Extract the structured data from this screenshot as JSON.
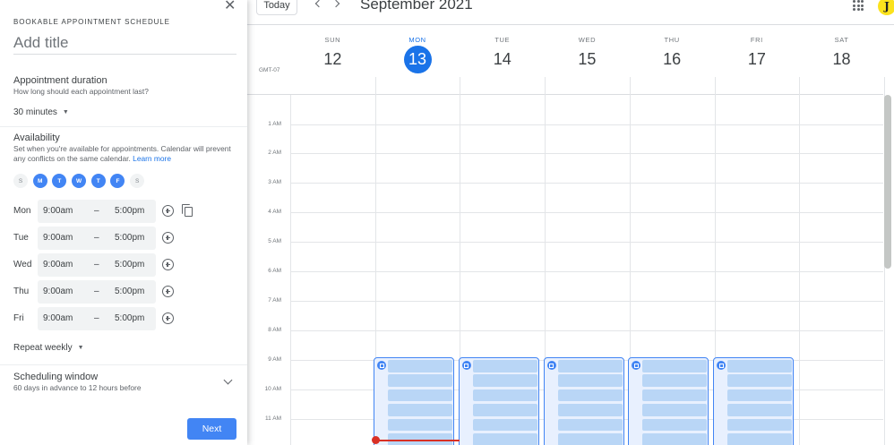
{
  "panel": {
    "heading": "BOOKABLE APPOINTMENT SCHEDULE",
    "close_icon": "close-icon",
    "title_placeholder": "Add title",
    "duration": {
      "heading": "Appointment duration",
      "subtitle": "How long should each appointment last?",
      "value": "30 minutes"
    },
    "availability": {
      "heading": "Availability",
      "description": "Set when you're available for appointments. Calendar will prevent any conflicts on the same calendar.",
      "learn_more": "Learn more",
      "day_chips": [
        {
          "letter": "S",
          "selected": false
        },
        {
          "letter": "M",
          "selected": true
        },
        {
          "letter": "T",
          "selected": true
        },
        {
          "letter": "W",
          "selected": true
        },
        {
          "letter": "T",
          "selected": true
        },
        {
          "letter": "F",
          "selected": true
        },
        {
          "letter": "S",
          "selected": false
        }
      ],
      "rows": [
        {
          "day": "Mon",
          "start": "9:00am",
          "dash": "–",
          "end": "5:00pm"
        },
        {
          "day": "Tue",
          "start": "9:00am",
          "dash": "–",
          "end": "5:00pm"
        },
        {
          "day": "Wed",
          "start": "9:00am",
          "dash": "–",
          "end": "5:00pm"
        },
        {
          "day": "Thu",
          "start": "9:00am",
          "dash": "–",
          "end": "5:00pm"
        },
        {
          "day": "Fri",
          "start": "9:00am",
          "dash": "–",
          "end": "5:00pm"
        }
      ]
    },
    "repeat": "Repeat weekly",
    "scheduling": {
      "heading": "Scheduling window",
      "subtitle": "60 days in advance to 12 hours before"
    },
    "next_label": "Next"
  },
  "topbar": {
    "today_label": "Today",
    "month_title": "September 2021",
    "avatar_letter": "J"
  },
  "calendar": {
    "timezone": "GMT-07",
    "days": [
      {
        "dow": "SUN",
        "date": "12",
        "today": false
      },
      {
        "dow": "MON",
        "date": "13",
        "today": true
      },
      {
        "dow": "TUE",
        "date": "14",
        "today": false
      },
      {
        "dow": "WED",
        "date": "15",
        "today": false
      },
      {
        "dow": "THU",
        "date": "16",
        "today": false
      },
      {
        "dow": "FRI",
        "date": "17",
        "today": false
      },
      {
        "dow": "SAT",
        "date": "18",
        "today": false
      }
    ],
    "hours": [
      "1 AM",
      "2 AM",
      "3 AM",
      "4 AM",
      "5 AM",
      "6 AM",
      "7 AM",
      "8 AM",
      "9 AM",
      "10 AM",
      "11 AM"
    ]
  },
  "colors": {
    "accent": "#1a73e8",
    "chip_selected": "#4285f4",
    "appointment_fill": "#b9d6f6",
    "current_time": "#d93025",
    "avatar_bg": "#fbe21d"
  }
}
